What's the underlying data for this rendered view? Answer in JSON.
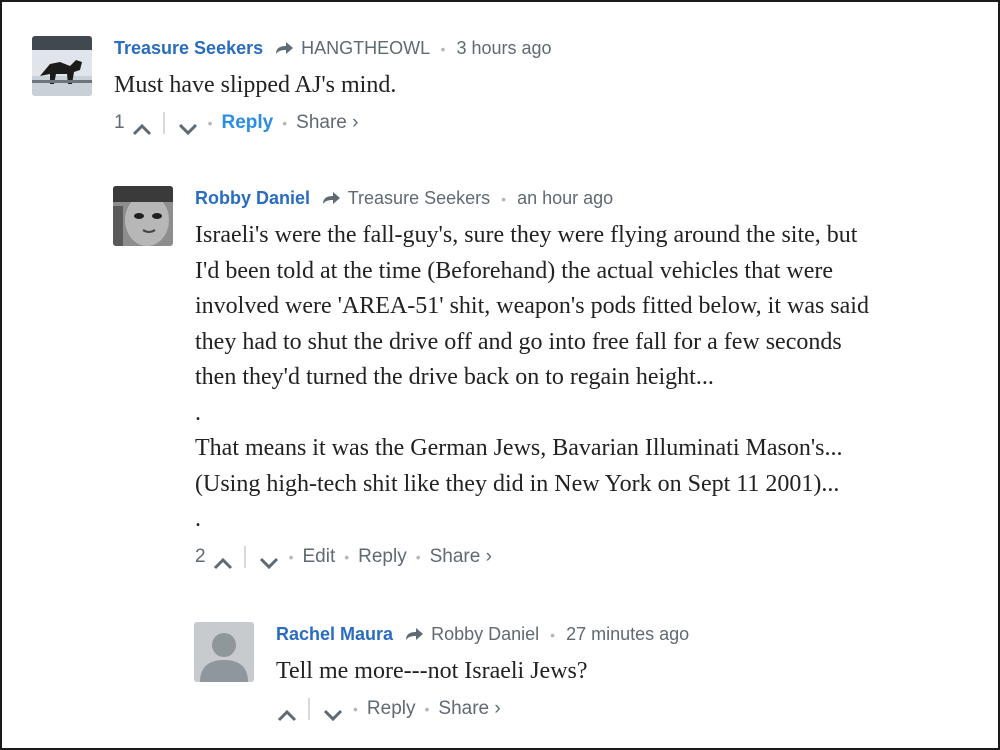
{
  "comments": [
    {
      "author": "Treasure Seekers",
      "reply_to": "HANGTHEOWL",
      "separator": "•",
      "time": "3 hours ago",
      "text": "Must have slipped AJ's mind.",
      "upvotes": "1",
      "reply_label": "Reply",
      "share_label": "Share ›",
      "avatar_icon": "horse-photo-avatar"
    },
    {
      "author": "Robby Daniel",
      "reply_to": "Treasure Seekers",
      "separator": "•",
      "time": "an hour ago",
      "text": "Israeli's were the fall-guy's, sure they were flying around the site, but\nI'd been told at the time (Beforehand) the actual vehicles that were\ninvolved were 'AREA-51' shit, weapon's pods fitted below, it was said\nthey had to shut the drive off and go into free fall for a few seconds\nthen they'd turned the drive back on to regain height...\n.\nThat means it was the German Jews, Bavarian Illuminati Mason's...\n(Using high-tech shit like they did in New York on Sept 11 2001)...\n.",
      "upvotes": "2",
      "edit_label": "Edit",
      "reply_label": "Reply",
      "share_label": "Share ›",
      "avatar_icon": "face-photo-avatar"
    },
    {
      "author": "Rachel Maura",
      "reply_to": "Robby Daniel",
      "separator": "•",
      "time": "27 minutes ago",
      "text": "Tell me more---not Israeli Jews?",
      "reply_label": "Reply",
      "share_label": "Share ›",
      "avatar_icon": "default-user-avatar"
    }
  ],
  "colors": {
    "author": "#2a6cc0",
    "reply_primary": "#2a8de8",
    "meta": "#5f6a72"
  }
}
